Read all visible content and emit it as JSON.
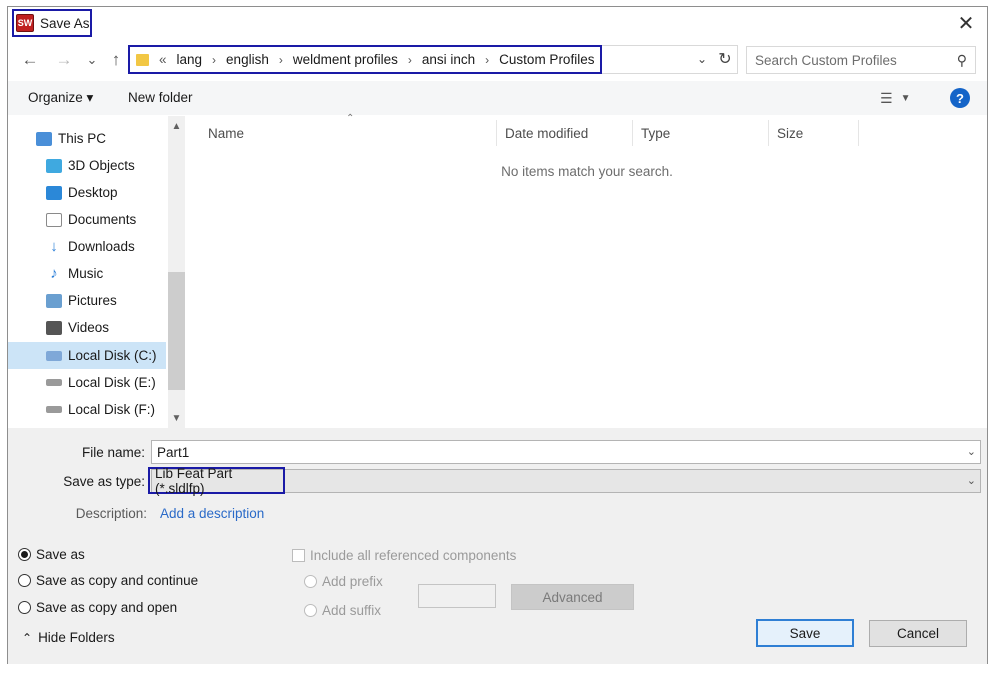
{
  "window": {
    "title": "Save As",
    "app_icon": "solidworks-icon",
    "close": "✕"
  },
  "nav": {
    "back": "←",
    "forward": "→",
    "recent": "⌄",
    "up": "↑"
  },
  "address": {
    "overflow": "«",
    "segments": [
      "lang",
      "english",
      "weldment profiles",
      "ansi inch",
      "Custom Profiles"
    ],
    "separator": "›"
  },
  "search": {
    "placeholder": "Search Custom Profiles"
  },
  "toolbar": {
    "organize": "Organize ▾",
    "new_folder": "New folder",
    "help": "?"
  },
  "sidebar": {
    "items": [
      {
        "label": "This PC",
        "icon": "pc-icon",
        "color": "#4a8fd8"
      },
      {
        "label": "3D Objects",
        "icon": "cube-icon",
        "color": "#3fa9e0"
      },
      {
        "label": "Desktop",
        "icon": "desktop-icon",
        "color": "#2b88d8"
      },
      {
        "label": "Documents",
        "icon": "documents-icon",
        "color": "#8a8a8a"
      },
      {
        "label": "Downloads",
        "icon": "download-icon",
        "color": "#2b7fd8"
      },
      {
        "label": "Music",
        "icon": "music-icon",
        "color": "#2b7fd8"
      },
      {
        "label": "Pictures",
        "icon": "pictures-icon",
        "color": "#6a9fd0"
      },
      {
        "label": "Videos",
        "icon": "videos-icon",
        "color": "#555555"
      },
      {
        "label": "Local Disk (C:)",
        "icon": "drive-c-icon",
        "color": "#7fa8d8"
      },
      {
        "label": "Local Disk (E:)",
        "icon": "drive-icon",
        "color": "#9a9a9a"
      },
      {
        "label": "Local Disk (F:)",
        "icon": "drive-icon",
        "color": "#9a9a9a"
      }
    ]
  },
  "columns": [
    "Name",
    "Date modified",
    "Type",
    "Size"
  ],
  "empty_message": "No items match your search.",
  "form": {
    "file_name_label": "File name:",
    "file_name_value": "Part1",
    "type_label": "Save as type:",
    "type_value": "Lib Feat Part (*.sldlfp)",
    "description_label": "Description:",
    "description_link": "Add a description"
  },
  "options": {
    "save_as": "Save as",
    "save_copy_continue": "Save as copy and continue",
    "save_copy_open": "Save as copy and open",
    "include_refs": "Include all referenced components",
    "add_prefix": "Add prefix",
    "add_suffix": "Add suffix",
    "advanced": "Advanced"
  },
  "footer": {
    "hide_folders": "Hide Folders",
    "save": "Save",
    "cancel": "Cancel"
  }
}
